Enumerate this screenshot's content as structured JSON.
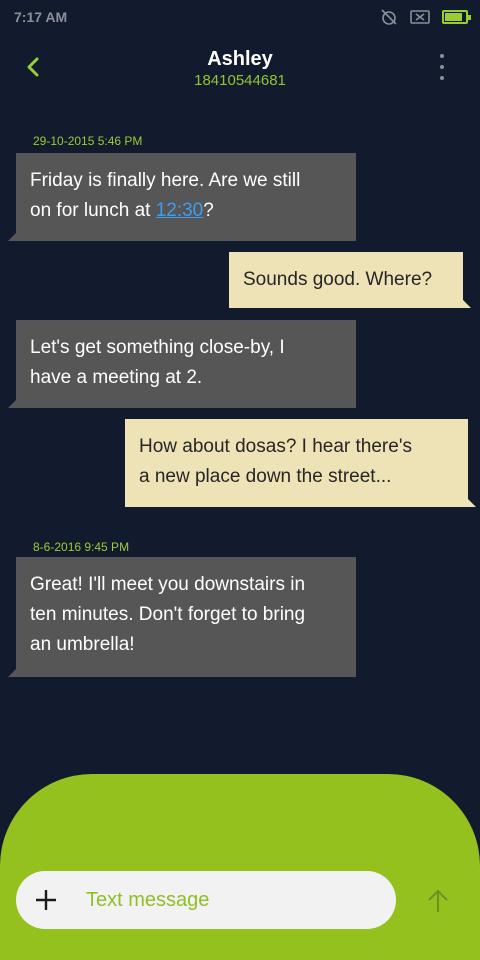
{
  "status_bar": {
    "time": "7:17 AM",
    "icons": [
      "alarm-off-icon",
      "sim-off-icon",
      "battery-icon"
    ],
    "battery_percent": 85
  },
  "header": {
    "contact_name": "Ashley",
    "contact_number": "18410544681",
    "back_icon": "chevron-left-icon",
    "more_icon": "more-vertical-icon"
  },
  "conversation": {
    "dates": [
      "29-10-2015 5:46 PM",
      "8-6-2016 9:45 PM"
    ],
    "messages": [
      {
        "direction": "incoming",
        "line1": "Friday is finally here. Are we still",
        "line2_before": "on for lunch at ",
        "line2_link": "12:30",
        "line2_after": "?"
      },
      {
        "direction": "outgoing",
        "line1": "Sounds good. Where?"
      },
      {
        "direction": "incoming",
        "line1": "Let's get something close-by, I",
        "line2": "have a meeting at 2."
      },
      {
        "direction": "outgoing",
        "line1": "How about dosas? I hear there's",
        "line2": "a new place down the street..."
      },
      {
        "direction": "incoming",
        "line1": "Great! I'll meet you downstairs in",
        "line2": "ten minutes. Don't forget to bring",
        "line3": "an umbrella!"
      }
    ]
  },
  "composer": {
    "placeholder": "Text message",
    "value": "",
    "add_icon": "plus-icon",
    "send_icon": "arrow-up-icon"
  },
  "colors": {
    "background": "#121b2e",
    "accent": "#95c11f",
    "incoming_bubble": "#565656",
    "outgoing_bubble": "#ede3b6",
    "link": "#3d9df0"
  }
}
